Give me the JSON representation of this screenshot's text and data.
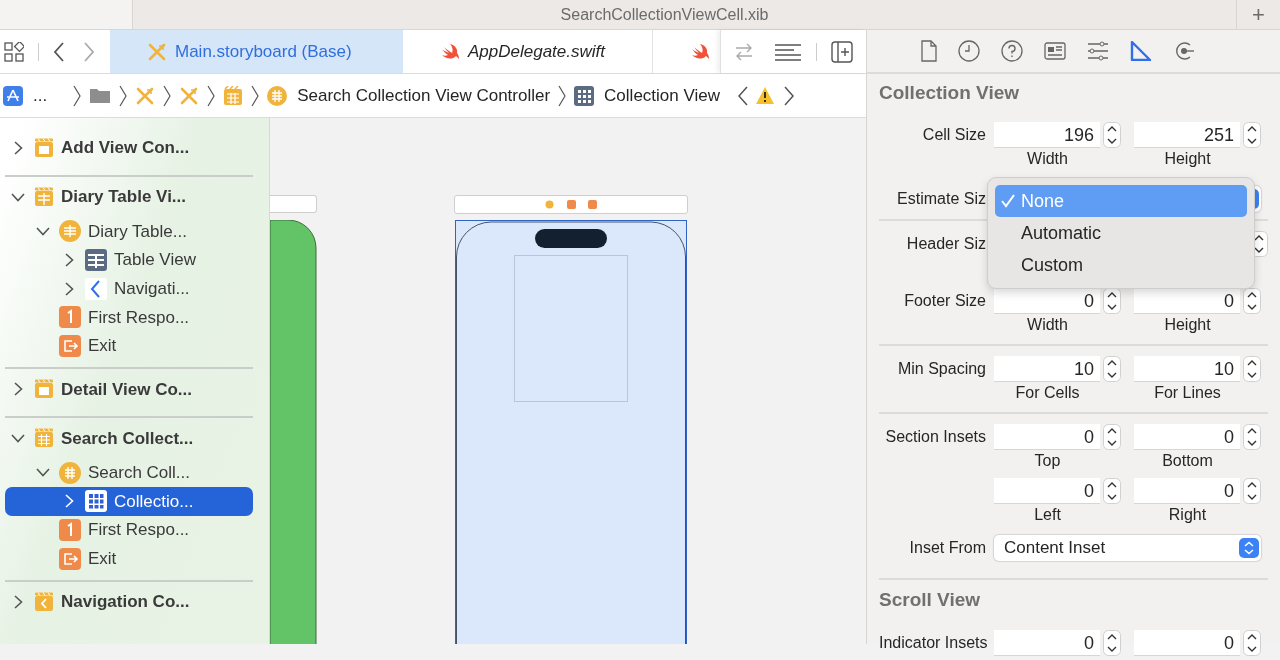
{
  "window": {
    "title": "SearchCollectionViewCell.xib",
    "add_symbol": "+"
  },
  "editor_tabs": [
    {
      "kind": "storyboard",
      "label": "Main.storyboard (Base)",
      "selected": true
    },
    {
      "kind": "swift",
      "label": "AppDelegate.swift",
      "selected": false
    },
    {
      "kind": "swift",
      "selected": false
    }
  ],
  "breadcrumb": [
    {
      "kind": "app",
      "label": "..."
    },
    {
      "kind": "folder"
    },
    {
      "kind": "storyboard"
    },
    {
      "kind": "storyboard"
    },
    {
      "kind": "scene"
    },
    {
      "kind": "controller",
      "label": "Search Collection View Controller"
    },
    {
      "kind": "collection",
      "label": "Collection View"
    }
  ],
  "outline": [
    {
      "kind": "scene",
      "label": "Add View Con...",
      "expanded": false,
      "selected": false
    },
    {
      "kind": "table-scene",
      "label": "Diary Table Vi...",
      "expanded": true,
      "selected": false,
      "children": [
        {
          "kind": "table-controller",
          "label": "Diary Table...",
          "expanded": true,
          "selected": false,
          "children": [
            {
              "kind": "table-view",
              "label": "Table View",
              "expanded": false,
              "selected": false
            },
            {
              "kind": "navigation-item",
              "label": "Navigati...",
              "expanded": false,
              "selected": false
            }
          ]
        },
        {
          "kind": "first-responder",
          "label": "First Respo...",
          "selected": false
        },
        {
          "kind": "exit",
          "label": "Exit",
          "selected": false
        }
      ]
    },
    {
      "kind": "scene",
      "label": "Detail View Co...",
      "expanded": false,
      "selected": false
    },
    {
      "kind": "collection-scene",
      "label": "Search Collect...",
      "expanded": true,
      "selected": false,
      "children": [
        {
          "kind": "collection-controller",
          "label": "Search Coll...",
          "expanded": true,
          "selected": false,
          "children": [
            {
              "kind": "collection-view",
              "label": "Collectio...",
              "expanded": false,
              "selected": true
            }
          ]
        },
        {
          "kind": "first-responder",
          "label": "First Respo...",
          "selected": false
        },
        {
          "kind": "exit",
          "label": "Exit",
          "selected": false
        }
      ]
    },
    {
      "kind": "nav-scene",
      "label": "Navigation Co...",
      "expanded": false,
      "selected": false
    }
  ],
  "inspector_tabs": [
    {
      "kind": "file",
      "selected": false
    },
    {
      "kind": "history",
      "selected": false
    },
    {
      "kind": "help",
      "selected": false
    },
    {
      "kind": "identity",
      "selected": false
    },
    {
      "kind": "attributes",
      "selected": false
    },
    {
      "kind": "size",
      "selected": true
    },
    {
      "kind": "connections",
      "selected": false
    }
  ],
  "inspector": {
    "sections": [
      {
        "title": "Collection View",
        "rows": [
          {
            "kind": "pair",
            "label": "Cell Size",
            "fields": [
              {
                "value": "196",
                "caption": "Width"
              },
              {
                "value": "251",
                "caption": "Height"
              }
            ]
          },
          {
            "kind": "popup",
            "label": "Estimate Siz",
            "divider": true
          },
          {
            "kind": "pair",
            "label": "Header Siz"
          },
          {
            "kind": "pair",
            "label": "Footer Size",
            "fields": [
              {
                "value": "0",
                "caption": "Width"
              },
              {
                "value": "0",
                "caption": "Height"
              }
            ],
            "divider": true
          },
          {
            "kind": "pair",
            "label": "Min Spacing",
            "fields": [
              {
                "value": "10",
                "caption": "For Cells"
              },
              {
                "value": "10",
                "caption": "For Lines"
              }
            ],
            "divider": true
          },
          {
            "kind": "pair",
            "label": "Section Insets",
            "fields": [
              {
                "value": "0",
                "caption": "Top"
              },
              {
                "value": "0",
                "caption": "Bottom"
              }
            ]
          },
          {
            "kind": "pair",
            "fields": [
              {
                "value": "0",
                "caption": "Left"
              },
              {
                "value": "0",
                "caption": "Right"
              }
            ]
          },
          {
            "kind": "popup",
            "label": "Inset From",
            "value": "Content Inset",
            "divider": true
          }
        ]
      },
      {
        "title": "Scroll View",
        "rows": [
          {
            "kind": "pair",
            "label": "Indicator Insets",
            "fields": [
              {
                "value": "0"
              },
              {
                "value": "0"
              }
            ]
          }
        ]
      }
    ]
  },
  "estimate_menu": [
    {
      "label": "None",
      "selected": true
    },
    {
      "label": "Automatic",
      "selected": false
    },
    {
      "label": "Custom",
      "selected": false
    }
  ]
}
